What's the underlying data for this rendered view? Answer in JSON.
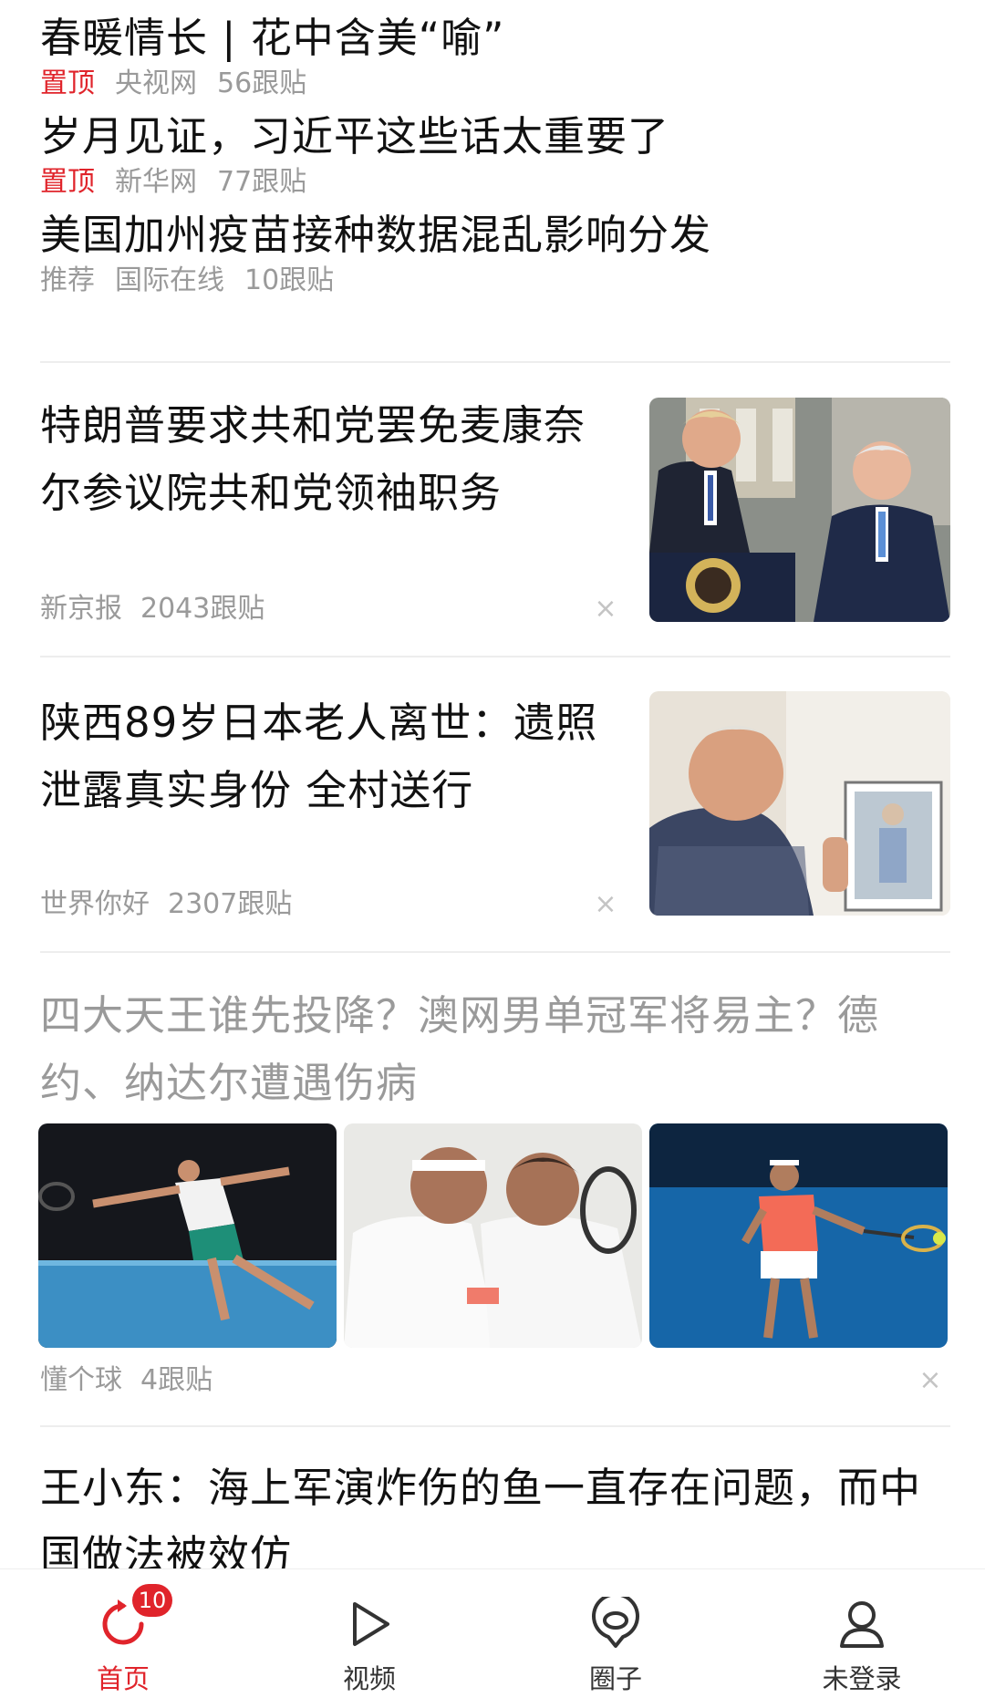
{
  "feed": {
    "pinned": [
      {
        "title": "春暖情长 | 花中含美“喻”",
        "tag": "置顶",
        "source": "央视网",
        "comments": "56跟贴"
      },
      {
        "title": "岁月见证，习近平这些话太重要了",
        "tag": "置顶",
        "source": "新华网",
        "comments": "77跟贴"
      },
      {
        "title": "美国加州疫苗接种数据混乱影响分发",
        "tag": "推荐",
        "source": "国际在线",
        "comments": "10跟贴"
      }
    ],
    "cards": [
      {
        "title": "特朗普要求共和党罢免麦康奈尔参议院共和党领袖职务",
        "source": "新京报",
        "comments": "2043跟贴",
        "close": "×"
      },
      {
        "title": "陕西89岁日本老人离世：遗照泄露真实身份 全村送行",
        "source": "世界你好",
        "comments": "2307跟贴",
        "close": "×"
      }
    ],
    "gallery": {
      "title": "四大天王谁先投降？澳网男单冠军将易主？德约、纳达尔遭遇伤病",
      "source": "懂个球",
      "comments": "4跟贴",
      "close": "×"
    },
    "last": {
      "title": "王小东：海上军演炸伤的鱼一直存在问题，而中国做法被效仿"
    }
  },
  "tabbar": {
    "tabs": [
      {
        "label": "首页",
        "icon": "refresh-icon",
        "badge": "10"
      },
      {
        "label": "视频",
        "icon": "play-icon"
      },
      {
        "label": "圈子",
        "icon": "location-pin-icon"
      },
      {
        "label": "未登录",
        "icon": "user-icon"
      }
    ]
  },
  "colors": {
    "accent": "#e0242b",
    "meta_text": "#9a9a9a",
    "read_title": "#9a9a9a"
  }
}
